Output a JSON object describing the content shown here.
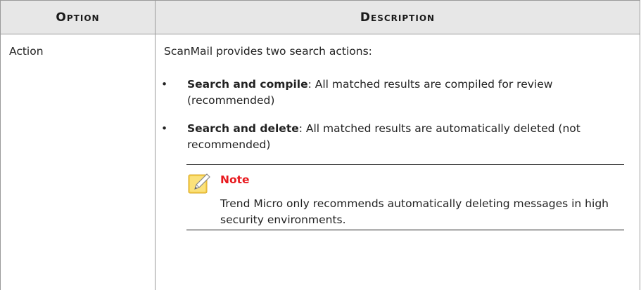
{
  "table": {
    "headers": {
      "option": "Option",
      "description": "Description"
    },
    "rows": [
      {
        "option": "Action",
        "intro": "ScanMail provides two search actions:",
        "bullets": [
          {
            "marker": "•",
            "term": "Search and compile",
            "text": ": All matched results are compiled for review (recommended)"
          },
          {
            "marker": "•",
            "term": "Search and delete",
            "text": ": All matched results are automatically deleted (not recommended)"
          }
        ],
        "note": {
          "icon": "note-pencil-icon",
          "label": "Note",
          "text": "Trend Micro only recommends automatically deleting messages in high security environments."
        }
      }
    ]
  },
  "colors": {
    "header_bg": "#e7e7e7",
    "border": "#9a9a9a",
    "note_label": "#e8191e",
    "note_icon_fill": "#f6d04d"
  }
}
